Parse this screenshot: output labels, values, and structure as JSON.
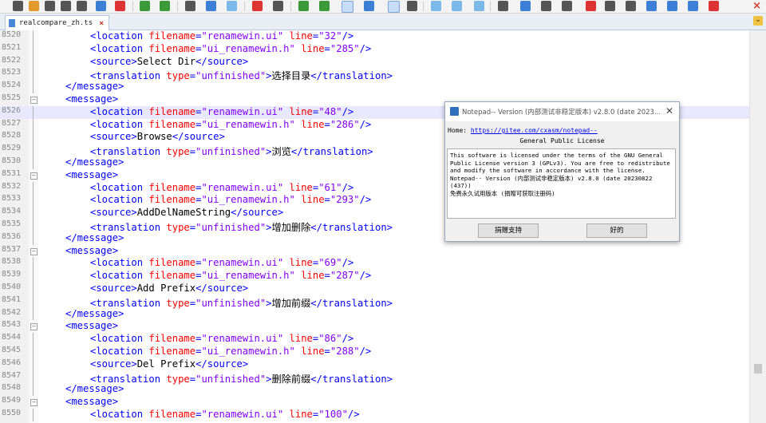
{
  "tab": {
    "filename": "realcompare_zh.ts",
    "close_glyph": "×"
  },
  "toolbar": {
    "close_glyph": "×"
  },
  "lines": [
    {
      "num": "8520",
      "indent": 2,
      "tag": "location",
      "attrs": [
        [
          "filename",
          "\"renamewin.ui\""
        ],
        [
          "line",
          "\"32\""
        ]
      ],
      "selfclose": true
    },
    {
      "num": "8521",
      "indent": 2,
      "tag": "location",
      "attrs": [
        [
          "filename",
          "\"ui_renamewin.h\""
        ],
        [
          "line",
          "\"285\""
        ]
      ],
      "selfclose": true
    },
    {
      "num": "8522",
      "indent": 2,
      "tag": "source",
      "text": "Select Dir"
    },
    {
      "num": "8523",
      "indent": 2,
      "tag": "translation",
      "attrs": [
        [
          "type",
          "\"unfinished\""
        ]
      ],
      "text": "选择目录"
    },
    {
      "num": "8524",
      "indent": 1,
      "close": "message"
    },
    {
      "num": "8525",
      "indent": 1,
      "open": "message",
      "fold": true
    },
    {
      "num": "8526",
      "indent": 2,
      "tag": "location",
      "attrs": [
        [
          "filename",
          "\"renamewin.ui\""
        ],
        [
          "line",
          "\"48\""
        ]
      ],
      "selfclose": true,
      "highlight": true
    },
    {
      "num": "8527",
      "indent": 2,
      "tag": "location",
      "attrs": [
        [
          "filename",
          "\"ui_renamewin.h\""
        ],
        [
          "line",
          "\"286\""
        ]
      ],
      "selfclose": true
    },
    {
      "num": "8528",
      "indent": 2,
      "tag": "source",
      "text": "Browse"
    },
    {
      "num": "8529",
      "indent": 2,
      "tag": "translation",
      "attrs": [
        [
          "type",
          "\"unfinished\""
        ]
      ],
      "text": "浏览"
    },
    {
      "num": "8530",
      "indent": 1,
      "close": "message"
    },
    {
      "num": "8531",
      "indent": 1,
      "open": "message",
      "fold": true
    },
    {
      "num": "8532",
      "indent": 2,
      "tag": "location",
      "attrs": [
        [
          "filename",
          "\"renamewin.ui\""
        ],
        [
          "line",
          "\"61\""
        ]
      ],
      "selfclose": true
    },
    {
      "num": "8533",
      "indent": 2,
      "tag": "location",
      "attrs": [
        [
          "filename",
          "\"ui_renamewin.h\""
        ],
        [
          "line",
          "\"293\""
        ]
      ],
      "selfclose": true
    },
    {
      "num": "8534",
      "indent": 2,
      "tag": "source",
      "text": "AddDelNameString"
    },
    {
      "num": "8535",
      "indent": 2,
      "tag": "translation",
      "attrs": [
        [
          "type",
          "\"unfinished\""
        ]
      ],
      "text": "增加删除"
    },
    {
      "num": "8536",
      "indent": 1,
      "close": "message"
    },
    {
      "num": "8537",
      "indent": 1,
      "open": "message",
      "fold": true
    },
    {
      "num": "8538",
      "indent": 2,
      "tag": "location",
      "attrs": [
        [
          "filename",
          "\"renamewin.ui\""
        ],
        [
          "line",
          "\"69\""
        ]
      ],
      "selfclose": true
    },
    {
      "num": "8539",
      "indent": 2,
      "tag": "location",
      "attrs": [
        [
          "filename",
          "\"ui_renamewin.h\""
        ],
        [
          "line",
          "\"287\""
        ]
      ],
      "selfclose": true
    },
    {
      "num": "8540",
      "indent": 2,
      "tag": "source",
      "text": "Add Prefix"
    },
    {
      "num": "8541",
      "indent": 2,
      "tag": "translation",
      "attrs": [
        [
          "type",
          "\"unfinished\""
        ]
      ],
      "text": "增加前缀"
    },
    {
      "num": "8542",
      "indent": 1,
      "close": "message"
    },
    {
      "num": "8543",
      "indent": 1,
      "open": "message",
      "fold": true
    },
    {
      "num": "8544",
      "indent": 2,
      "tag": "location",
      "attrs": [
        [
          "filename",
          "\"renamewin.ui\""
        ],
        [
          "line",
          "\"86\""
        ]
      ],
      "selfclose": true
    },
    {
      "num": "8545",
      "indent": 2,
      "tag": "location",
      "attrs": [
        [
          "filename",
          "\"ui_renamewin.h\""
        ],
        [
          "line",
          "\"288\""
        ]
      ],
      "selfclose": true
    },
    {
      "num": "8546",
      "indent": 2,
      "tag": "source",
      "text": "Del Prefix"
    },
    {
      "num": "8547",
      "indent": 2,
      "tag": "translation",
      "attrs": [
        [
          "type",
          "\"unfinished\""
        ]
      ],
      "text": "删除前缀"
    },
    {
      "num": "8548",
      "indent": 1,
      "close": "message"
    },
    {
      "num": "8549",
      "indent": 1,
      "open": "message",
      "fold": true
    },
    {
      "num": "8550",
      "indent": 2,
      "tag": "location",
      "attrs": [
        [
          "filename",
          "\"renamewin.ui\""
        ],
        [
          "line",
          "\"100\""
        ]
      ],
      "selfclose": true
    }
  ],
  "dialog": {
    "title": "Notepad-- Version (内部测试非稳定版本) v2.8.0 (date 2023...",
    "close_glyph": "✕",
    "home_label": "Home:",
    "home_link": "https://gitee.com/cxasm/notepad--",
    "license_heading": "General Public License",
    "text_lines": [
      "This software is licensed under the terms of the GNU General",
      "Public License version 3 (GPLv3). You are free to redistribute",
      "and modify the software in accordance with the license.",
      "Notepad-- Version (内部测试非稳定版本) v2.8.0 (date 20230822",
      "(437))",
      "免费永久试用版本 (捐赠可获取注册码)"
    ],
    "donate_button": "捐赠支持",
    "ok_button": "好的"
  }
}
